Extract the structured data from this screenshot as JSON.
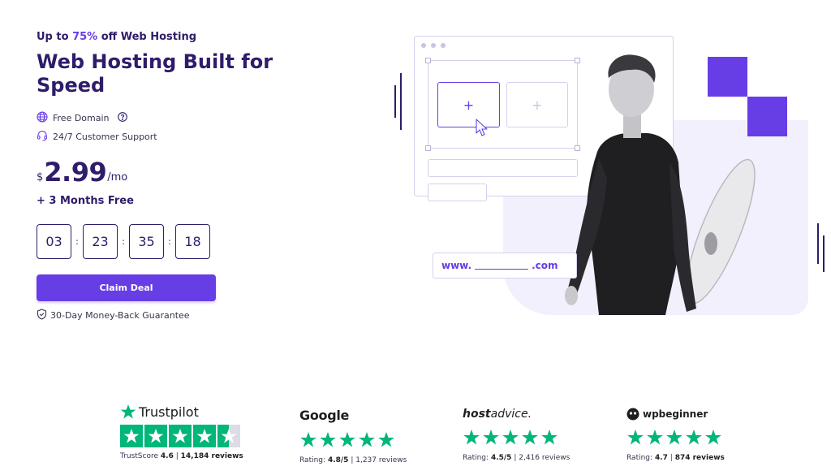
{
  "hero": {
    "promo_prefix": "Up to",
    "promo_percent": "75%",
    "promo_suffix": "off Web Hosting",
    "title": "Web Hosting Built for Speed",
    "features": [
      {
        "icon": "globe-icon",
        "label": "Free Domain",
        "extra_icon": "help-circle-icon"
      },
      {
        "icon": "headset-icon",
        "label": "24/7 Customer Support"
      }
    ],
    "price": {
      "currency": "$",
      "amount": "2.99",
      "period": "/mo"
    },
    "bonus": "+ 3 Months Free",
    "countdown": [
      "03",
      "23",
      "35",
      "18"
    ],
    "countdown_separator": ":",
    "cta_label": "Claim Deal",
    "guarantee": "30-Day Money-Back Guarantee"
  },
  "illustration": {
    "url_prefix": "www.",
    "url_suffix": ".com",
    "accent_color": "#673de6",
    "panel_color": "#f2f0fd"
  },
  "ratings": [
    {
      "brand": "Trustpilot",
      "label": "TrustScore",
      "score": "4.6",
      "sep": "|",
      "reviews": "14,184 reviews",
      "stars": 4.5
    },
    {
      "brand": "Google",
      "label": "Rating:",
      "score": "4.8/5",
      "sep": "|",
      "reviews": "1,237 reviews",
      "stars": 5
    },
    {
      "brand_main": "host",
      "brand_light": "advice.",
      "label": "Rating:",
      "score": "4.5/5",
      "sep": "|",
      "reviews": "2,416 reviews",
      "stars": 5
    },
    {
      "brand": "wpbeginner",
      "label": "Rating:",
      "score": "4.7",
      "sep": "|",
      "reviews": "874 reviews",
      "stars": 5
    }
  ],
  "colors": {
    "primary": "#673de6",
    "dark": "#2f1c6a",
    "star_green": "#00b67a"
  }
}
